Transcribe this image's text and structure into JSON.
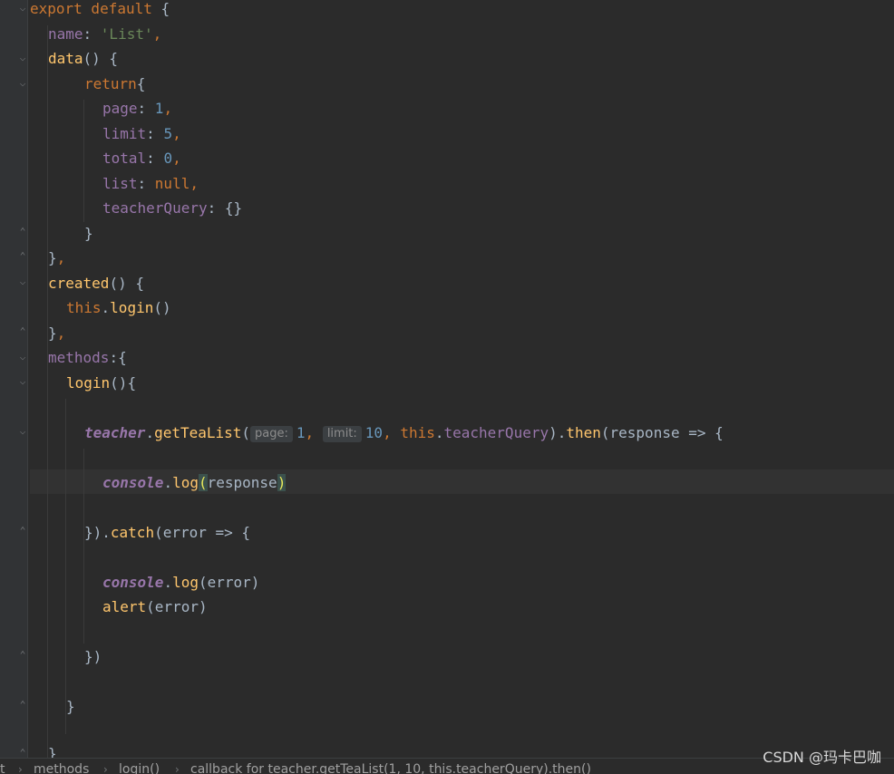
{
  "code": {
    "l1_kw": "export default",
    "l1_brace": " {",
    "l2_key": "name",
    "l2_val": "'List'",
    "l3_fn": "data",
    "l3_rest": "() {",
    "l4_kw": "return",
    "l4_rest": "{",
    "l5_key": "page",
    "l5_val": "1",
    "l6_key": "limit",
    "l6_val": "5",
    "l7_key": "total",
    "l7_val": "0",
    "l8_key": "list",
    "l8_val": "null",
    "l9_key": "teacherQuery",
    "l9_val": "{}",
    "l10": "}",
    "l11": "}",
    "l12_fn": "created",
    "l12_rest": "() {",
    "l13_this": "this",
    "l13_fn": "login",
    "l13_rest": "()",
    "l14": "}",
    "l15_key": "methods",
    "l15_rest": ":{",
    "l16_fn": "login",
    "l16_rest": "(){",
    "l18_obj": "teacher",
    "l18_fn": "getTeaList",
    "hint_page": "page:",
    "arg1": "1",
    "hint_limit": "limit:",
    "arg2": "10",
    "l18_this": "this",
    "l18_query": "teacherQuery",
    "l18_then": "then",
    "l18_tail": "(response => {",
    "l20_obj": "console",
    "l20_fn": "log",
    "l20_arg": "response",
    "l22_a": "})",
    "l22_fn": "catch",
    "l22_tail": "(error => {",
    "l24_obj": "console",
    "l24_fn": "log",
    "l24_tail": "(error)",
    "l25_fn": "alert",
    "l25_tail": "(error)",
    "l27": "})",
    "l29": "}",
    "l31": "}"
  },
  "breadcrumb": [
    "t",
    "methods",
    "login()",
    "callback for teacher.getTeaList(1, 10, this.teacherQuery).then()"
  ],
  "watermark": "CSDN @玛卡巴咖"
}
